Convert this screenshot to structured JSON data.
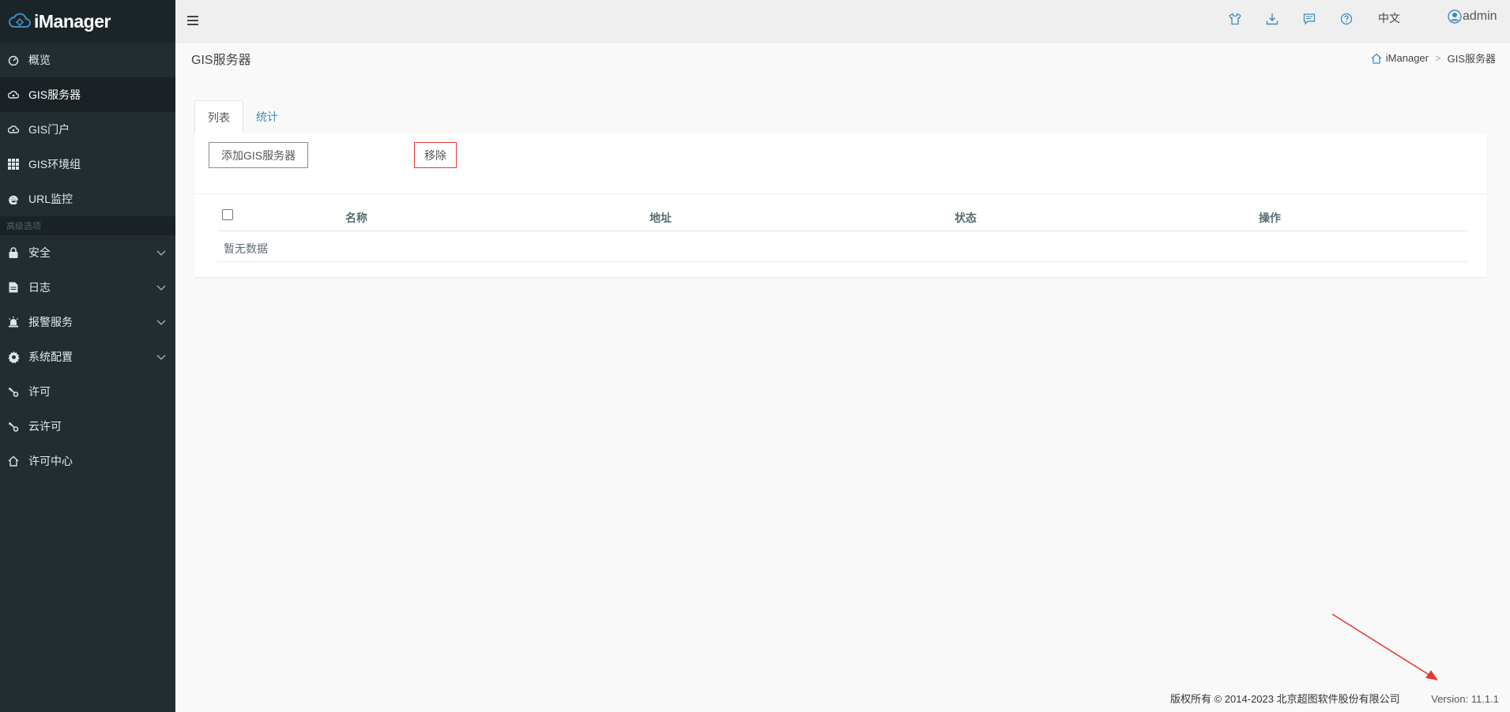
{
  "app": {
    "name": "iManager"
  },
  "header": {
    "language": "中文",
    "user": "admin"
  },
  "sidebar": {
    "items": [
      {
        "label": "概览",
        "icon": "dashboard-icon"
      },
      {
        "label": "GIS服务器",
        "icon": "cloud-server-icon",
        "active": true
      },
      {
        "label": "GIS门户",
        "icon": "cloud-portal-icon"
      },
      {
        "label": "GIS环境组",
        "icon": "grid-icon"
      },
      {
        "label": "URL监控",
        "icon": "ie-icon"
      }
    ],
    "section_header": "高级选项",
    "advanced": [
      {
        "label": "安全",
        "icon": "lock-icon",
        "expandable": true
      },
      {
        "label": "日志",
        "icon": "file-icon",
        "expandable": true
      },
      {
        "label": "报警服务",
        "icon": "alarm-icon",
        "expandable": true
      },
      {
        "label": "系统配置",
        "icon": "gear-icon",
        "expandable": true
      },
      {
        "label": "许可",
        "icon": "key-icon"
      },
      {
        "label": "云许可",
        "icon": "key-icon"
      },
      {
        "label": "许可中心",
        "icon": "home-icon"
      }
    ]
  },
  "page": {
    "title": "GIS服务器",
    "breadcrumb": [
      "iManager",
      "GIS服务器"
    ]
  },
  "tabs": [
    {
      "label": "列表",
      "active": true
    },
    {
      "label": "统计",
      "active": false
    }
  ],
  "toolbar": {
    "add_label": "添加GIS服务器",
    "remove_label": "移除"
  },
  "table": {
    "columns": [
      "名称",
      "地址",
      "状态",
      "操作"
    ],
    "empty_text": "暂无数据"
  },
  "footer": {
    "copyright": "版权所有 © 2014-2023 北京超图软件股份有限公司",
    "version": "Version: 11.1.1"
  },
  "colors": {
    "sidebar_bg": "#222d32",
    "accent": "#3c8dbc",
    "danger": "#e53935"
  }
}
